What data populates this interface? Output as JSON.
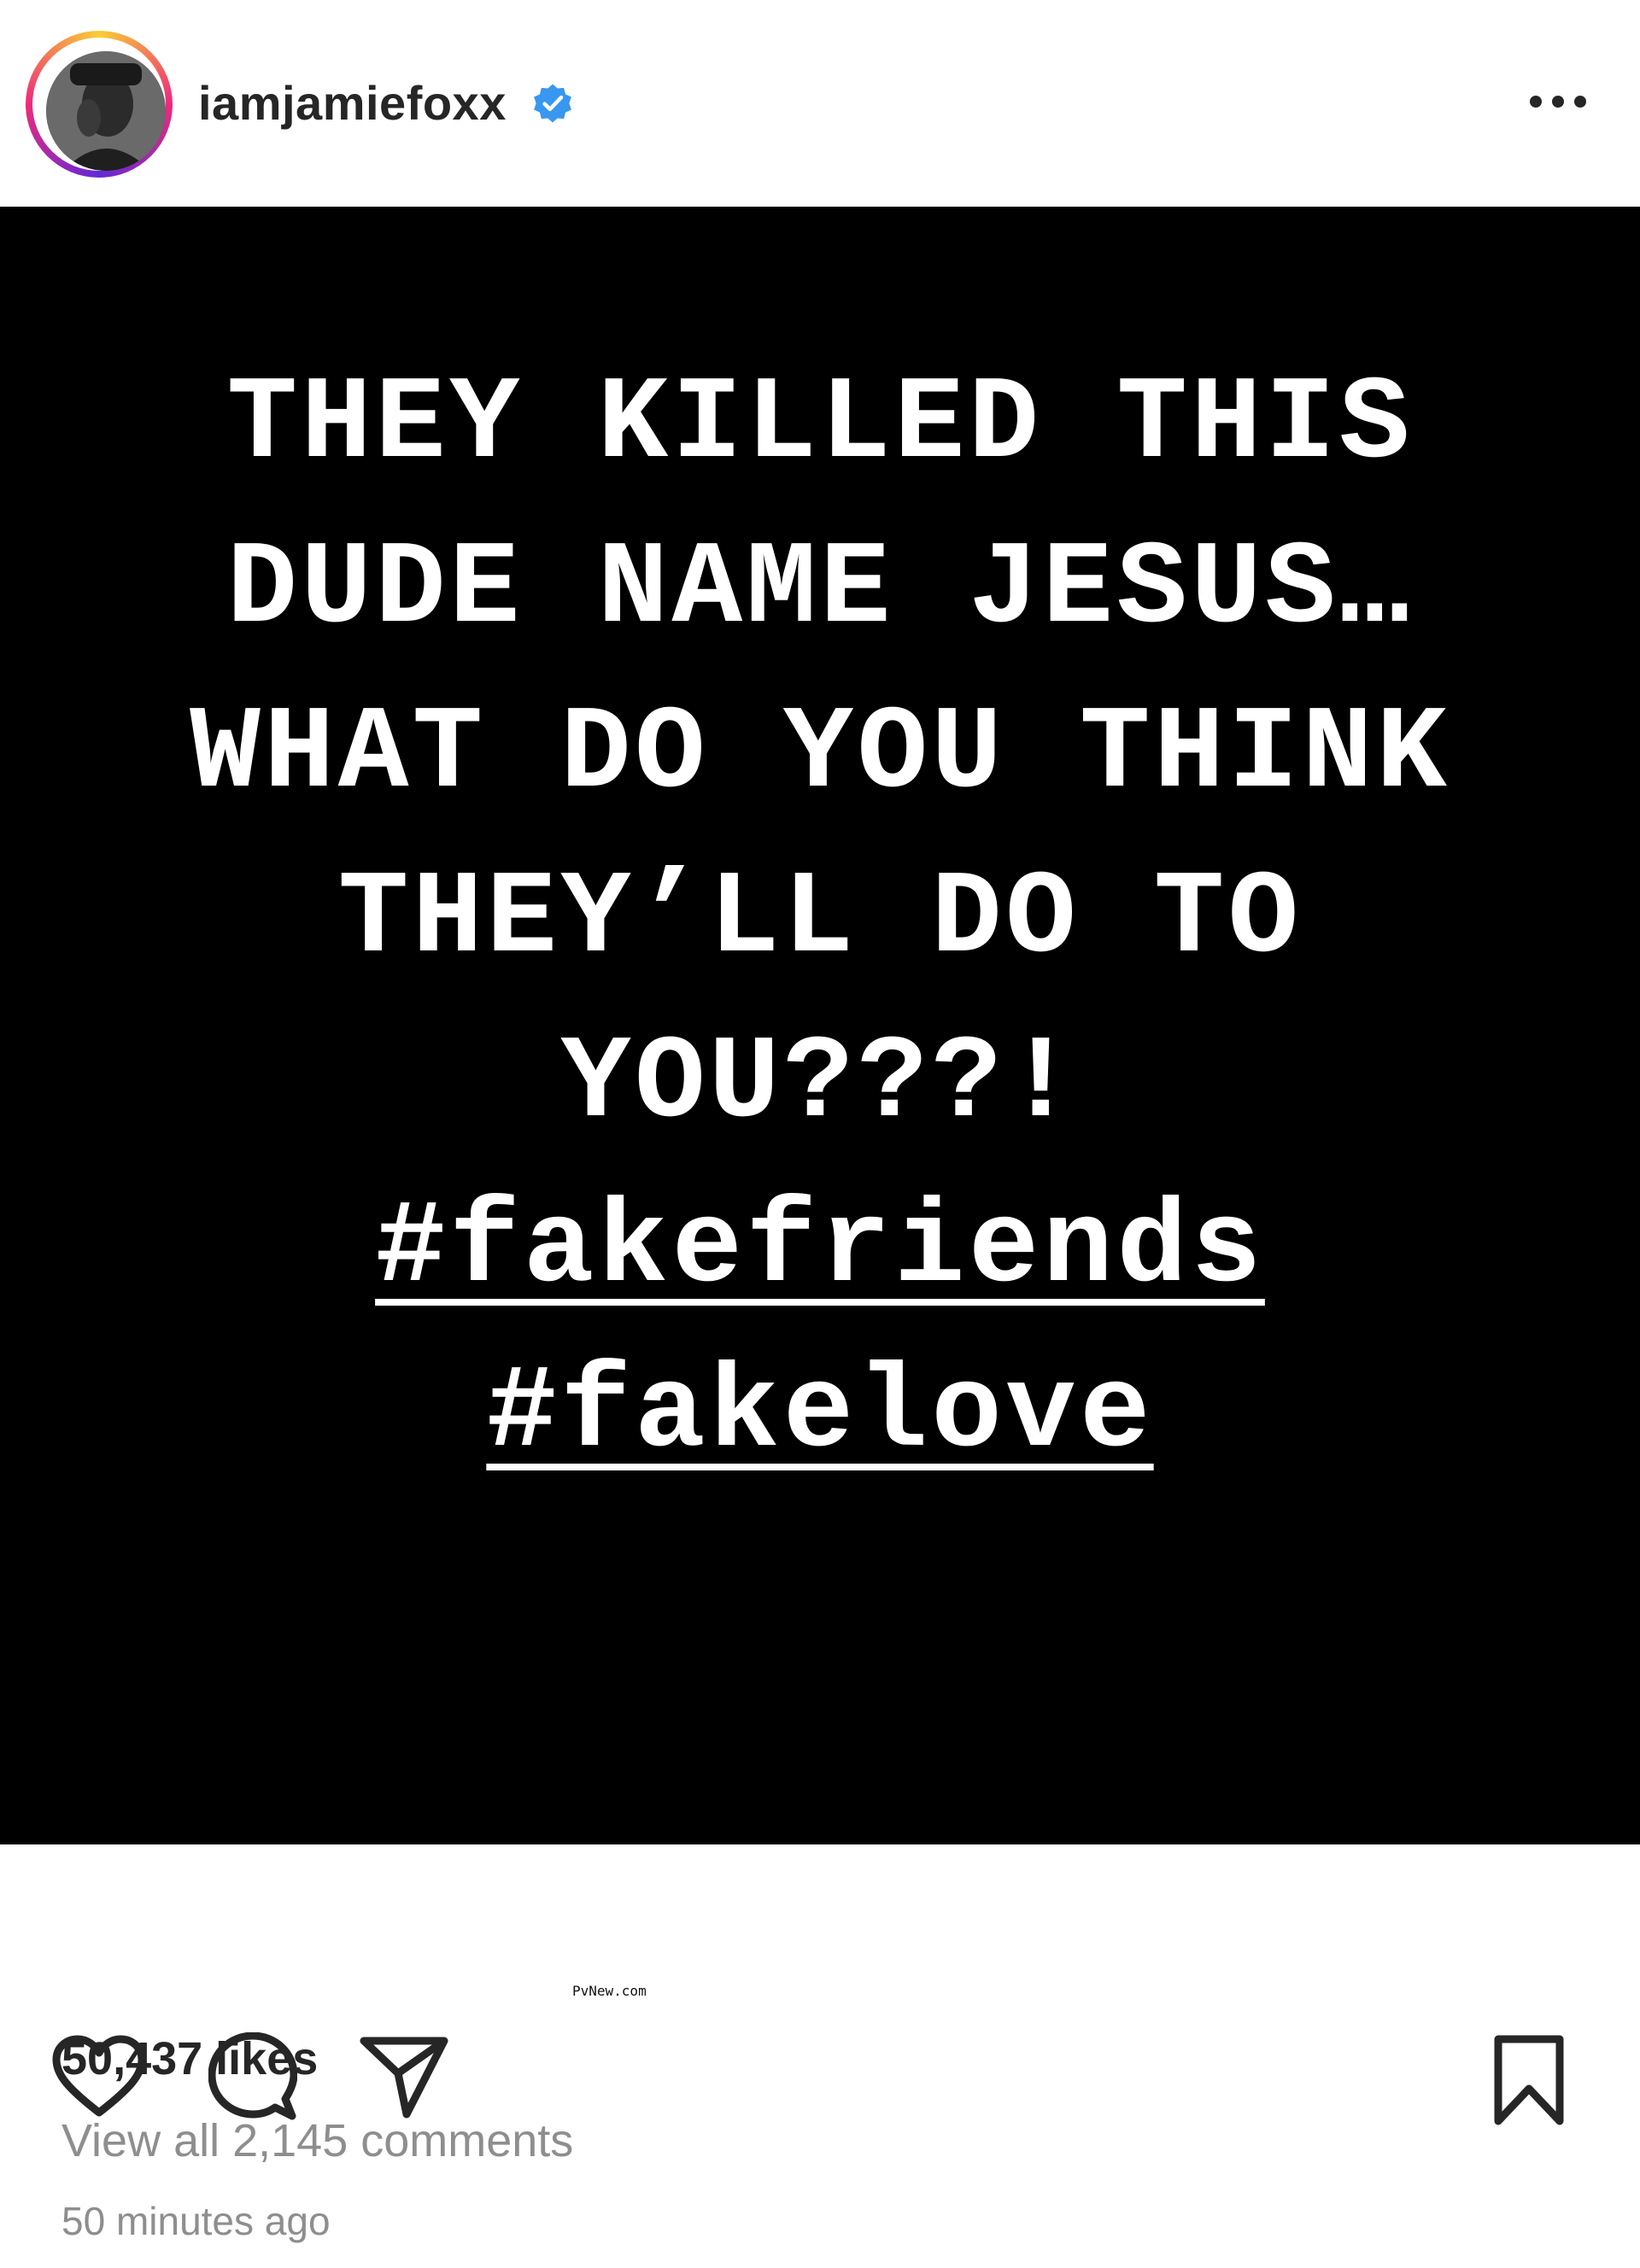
{
  "header": {
    "username": "iamjamiefoxx",
    "verified": true,
    "icons": {
      "verified": "verified-badge-icon",
      "more": "more-options-icon"
    }
  },
  "post": {
    "lines": [
      "THEY KILLED THIS",
      "DUDE NAME JESUS…",
      "WHAT DO YOU THINK",
      "THEY’LL DO TO",
      "YOU???!"
    ],
    "hashtags": [
      "#fakefriends",
      "#fakelove"
    ]
  },
  "actions": {
    "icons": [
      "heart-icon",
      "comment-icon",
      "share-icon",
      "bookmark-icon"
    ]
  },
  "watermark": "PvNew.com",
  "stats": {
    "likes": "50,437 likes",
    "comments": "View all 2,145 comments",
    "time": "50 minutes ago"
  },
  "colors": {
    "verified": "#3897f0",
    "muted_text": "#8e8e8e",
    "post_background": "#000000"
  }
}
